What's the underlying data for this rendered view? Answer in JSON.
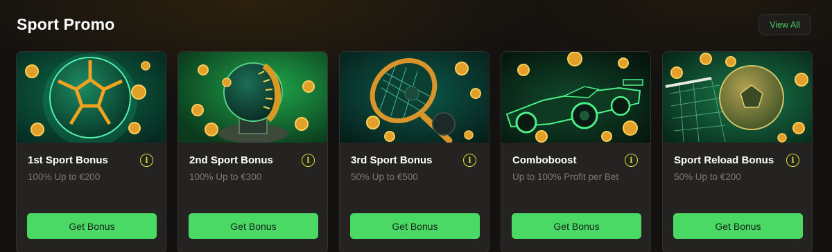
{
  "header": {
    "title": "Sport Promo",
    "view_all_label": "View All"
  },
  "colors": {
    "accent_green": "#4ad964",
    "info_yellow": "#d7e63a",
    "card_bg": "#252321",
    "page_bg": "#141210"
  },
  "cards": [
    {
      "title": "1st Sport Bonus",
      "subtitle": "100% Up to €200",
      "button": "Get Bonus",
      "image": "glowing-soccer-ball-with-coins",
      "info_icon": "info-icon"
    },
    {
      "title": "2nd Sport Bonus",
      "subtitle": "100% Up to €300",
      "button": "Get Bonus",
      "image": "rugby-ball-trophy-with-coins",
      "info_icon": "info-icon"
    },
    {
      "title": "3rd Sport Bonus",
      "subtitle": "50% Up to €500",
      "button": "Get Bonus",
      "image": "tennis-racket-and-ball-with-coins",
      "info_icon": "info-icon"
    },
    {
      "title": "Comboboost",
      "subtitle": "Up to 100% Profit per Bet",
      "button": "Get Bonus",
      "image": "formula-one-race-car-with-coins",
      "info_icon": "info-icon"
    },
    {
      "title": "Sport Reload Bonus",
      "subtitle": "50% Up to €200",
      "button": "Get Bonus",
      "image": "soccer-ball-and-goal-net-with-coins",
      "info_icon": "info-icon"
    }
  ]
}
